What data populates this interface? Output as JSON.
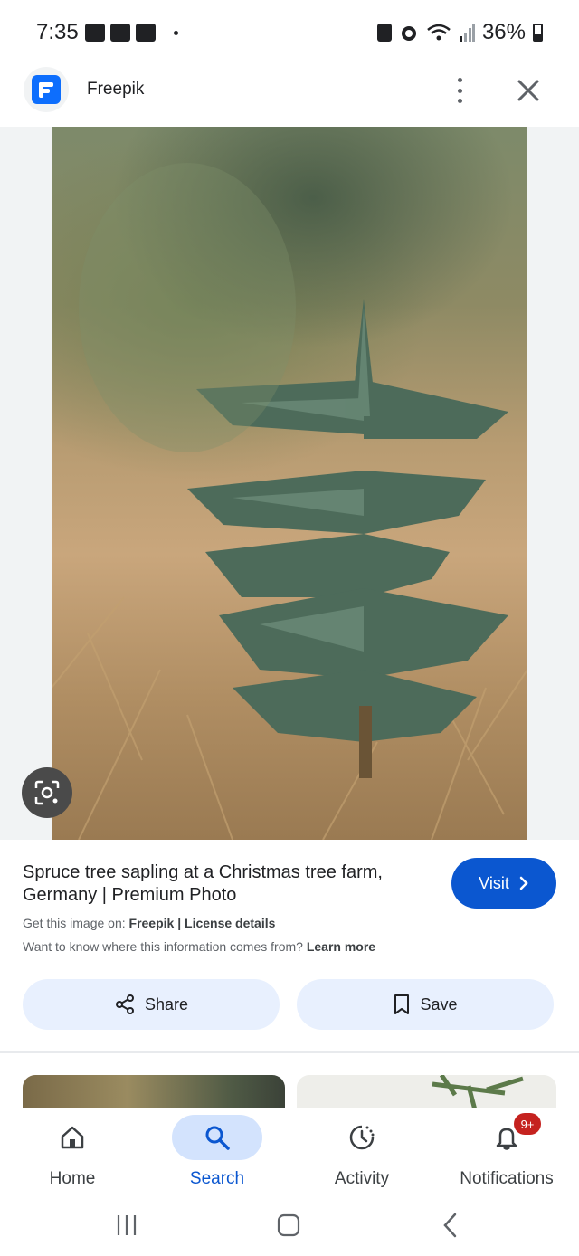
{
  "status_bar": {
    "time": "7:35",
    "battery_percent": "36%",
    "left_icons": [
      "gallery-icon",
      "youtube-icon",
      "news-icon",
      "dot-icon"
    ],
    "right_icons": [
      "battery-saver-icon",
      "alarm-icon",
      "wifi-icon",
      "signal-icon",
      "battery-icon"
    ]
  },
  "header": {
    "site_name": "Freepik",
    "logo_icon": "freepik-logo-icon",
    "accent": "#0d6efd"
  },
  "result": {
    "title": "Spruce tree sapling at a Christmas tree farm, Germany | Premium Photo",
    "visit_label": "Visit",
    "source_prefix": "Get this image on:",
    "source_site": "Freepik",
    "separator": "|",
    "license_label": "License details",
    "info_question": "Want to know where this information comes from?",
    "learn_more": "Learn more",
    "share_label": "Share",
    "save_label": "Save"
  },
  "bottom_nav": {
    "items": [
      {
        "label": "Home",
        "icon": "home-icon",
        "active": false
      },
      {
        "label": "Search",
        "icon": "search-icon",
        "active": true
      },
      {
        "label": "Activity",
        "icon": "activity-icon",
        "active": false
      },
      {
        "label": "Notifications",
        "icon": "bell-icon",
        "active": false,
        "badge": "9+"
      }
    ]
  },
  "colors": {
    "primary": "#0b57d0",
    "pill_bg": "#e8f0fe",
    "active_nav_bg": "#d3e3fd",
    "badge": "#c5221f"
  }
}
